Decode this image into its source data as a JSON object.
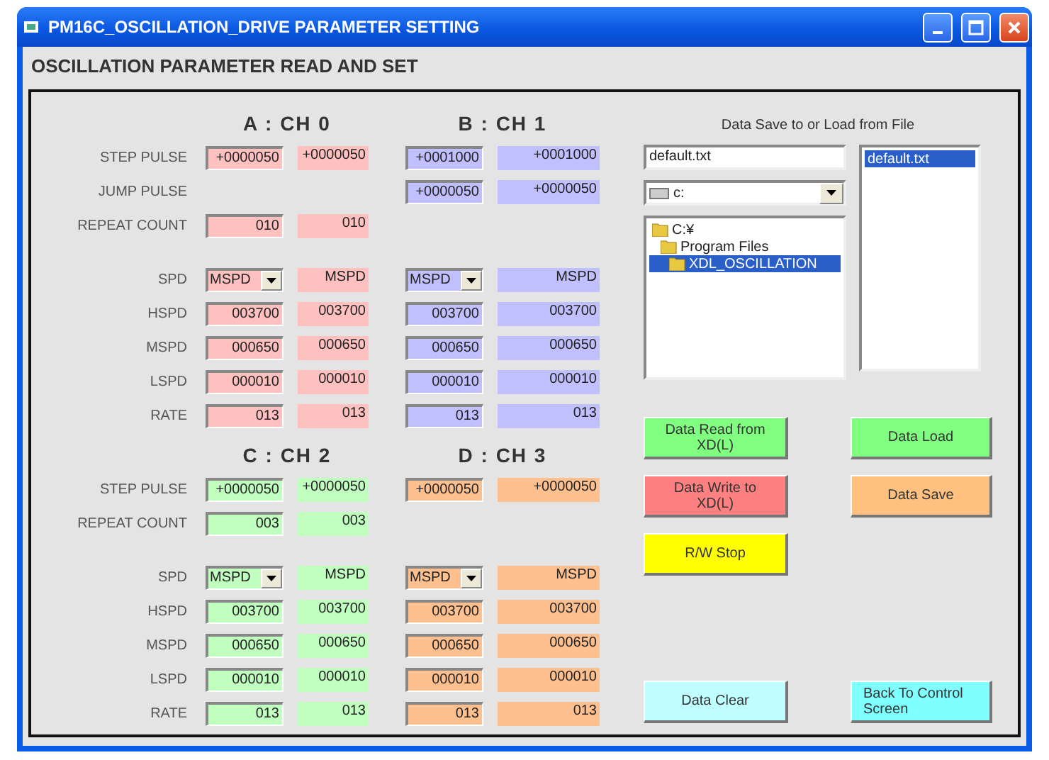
{
  "window": {
    "title": "PM16C_OSCILLATION_DRIVE PARAMETER SETTING"
  },
  "heading": "OSCILLATION PARAMETER READ AND SET",
  "blocks": [
    {
      "channels": [
        {
          "title": "A : CH 0",
          "color": "#ffc0c0"
        },
        {
          "title": "B : CH 1",
          "color": "#c0c0ff"
        }
      ],
      "pulse_rows": [
        {
          "label": "STEP PULSE",
          "kind": "field",
          "cells": [
            {
              "input": "+0000050",
              "display": "+0000050"
            },
            {
              "input": "+0001000",
              "display": "+0001000"
            }
          ]
        },
        {
          "label": "JUMP PULSE",
          "kind": "field",
          "cells": [
            null,
            {
              "input": "+0000050",
              "display": "+0000050"
            }
          ]
        },
        {
          "label": "REPEAT COUNT",
          "kind": "field",
          "cells": [
            {
              "input": "010",
              "display": "010"
            },
            null
          ]
        }
      ],
      "speed_rows": [
        {
          "label": "SPD",
          "kind": "combo",
          "cells": [
            {
              "input": "MSPD",
              "display": "MSPD"
            },
            {
              "input": "MSPD",
              "display": "MSPD"
            }
          ]
        },
        {
          "label": "HSPD",
          "kind": "field",
          "cells": [
            {
              "input": "003700",
              "display": "003700"
            },
            {
              "input": "003700",
              "display": "003700"
            }
          ]
        },
        {
          "label": "MSPD",
          "kind": "field",
          "cells": [
            {
              "input": "000650",
              "display": "000650"
            },
            {
              "input": "000650",
              "display": "000650"
            }
          ]
        },
        {
          "label": "LSPD",
          "kind": "field",
          "cells": [
            {
              "input": "000010",
              "display": "000010"
            },
            {
              "input": "000010",
              "display": "000010"
            }
          ]
        },
        {
          "label": "RATE",
          "kind": "field",
          "cells": [
            {
              "input": "013",
              "display": "013"
            },
            {
              "input": "013",
              "display": "013"
            }
          ]
        }
      ]
    },
    {
      "channels": [
        {
          "title": "C : CH 2",
          "color": "#c0ffc0"
        },
        {
          "title": "D : CH 3",
          "color": "#ffc090"
        }
      ],
      "pulse_rows": [
        {
          "label": "STEP PULSE",
          "kind": "field",
          "cells": [
            {
              "input": "+0000050",
              "display": "+0000050"
            },
            {
              "input": "+0000050",
              "display": "+0000050"
            }
          ]
        },
        {
          "label": "REPEAT COUNT",
          "kind": "field",
          "cells": [
            {
              "input": "003",
              "display": "003"
            },
            null
          ]
        }
      ],
      "speed_rows": [
        {
          "label": "SPD",
          "kind": "combo",
          "cells": [
            {
              "input": "MSPD",
              "display": "MSPD"
            },
            {
              "input": "MSPD",
              "display": "MSPD"
            }
          ]
        },
        {
          "label": "HSPD",
          "kind": "field",
          "cells": [
            {
              "input": "003700",
              "display": "003700"
            },
            {
              "input": "003700",
              "display": "003700"
            }
          ]
        },
        {
          "label": "MSPD",
          "kind": "field",
          "cells": [
            {
              "input": "000650",
              "display": "000650"
            },
            {
              "input": "000650",
              "display": "000650"
            }
          ]
        },
        {
          "label": "LSPD",
          "kind": "field",
          "cells": [
            {
              "input": "000010",
              "display": "000010"
            },
            {
              "input": "000010",
              "display": "000010"
            }
          ]
        },
        {
          "label": "RATE",
          "kind": "field",
          "cells": [
            {
              "input": "013",
              "display": "013"
            },
            {
              "input": "013",
              "display": "013"
            }
          ]
        }
      ]
    }
  ],
  "file_panel": {
    "caption": "Data Save to or Load from File",
    "filename": "default.txt",
    "drive": "c:",
    "folders": [
      {
        "name": "C:¥",
        "selected": false,
        "children": [
          {
            "name": "Program Files",
            "selected": false,
            "children": [
              {
                "name": "XDL_OSCILLATION",
                "selected": true
              }
            ]
          }
        ]
      }
    ],
    "files": [
      {
        "name": "default.txt",
        "selected": true
      }
    ]
  },
  "button_rows": [
    [
      {
        "label": "Data Read from XD(L)",
        "color": "#80ff80"
      },
      {
        "label": "Data Load",
        "color": "#80ff80"
      }
    ],
    [
      {
        "label": "Data Write to XD(L)",
        "color": "#ff8080"
      },
      {
        "label": "Data Save",
        "color": "#ffc080"
      }
    ],
    [
      {
        "label": "R/W Stop",
        "color": "#ffff00"
      }
    ],
    [
      {
        "label": "Data Clear",
        "color": "#c0ffff"
      },
      {
        "label": "Back To Control Screen",
        "color": "#80ffff"
      }
    ]
  ]
}
